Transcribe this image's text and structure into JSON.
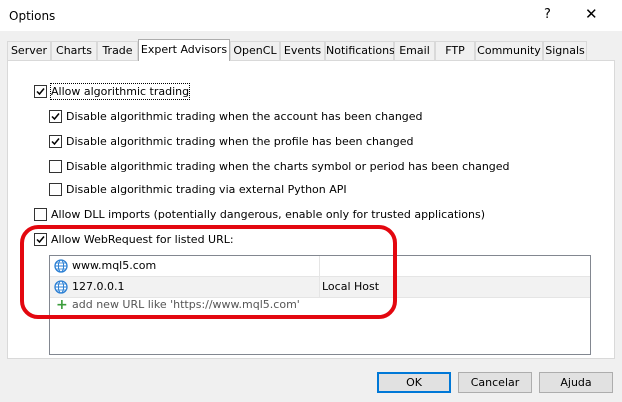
{
  "window": {
    "title": "Options",
    "help_glyph": "?",
    "close_glyph": "✕"
  },
  "tabs": [
    {
      "label": "Server"
    },
    {
      "label": "Charts"
    },
    {
      "label": "Trade"
    },
    {
      "label": "Expert Advisors",
      "active": true
    },
    {
      "label": "OpenCL"
    },
    {
      "label": "Events"
    },
    {
      "label": "Notifications"
    },
    {
      "label": "Email"
    },
    {
      "label": "FTP"
    },
    {
      "label": "Community"
    },
    {
      "label": "Signals"
    }
  ],
  "options": {
    "allow_algo": {
      "label": "Allow algorithmic trading",
      "checked": true
    },
    "disable_account": {
      "label": "Disable algorithmic trading when the account has been changed",
      "checked": true
    },
    "disable_profile": {
      "label": "Disable algorithmic trading when the profile has been changed",
      "checked": true
    },
    "disable_symbol": {
      "label": "Disable algorithmic trading when the charts symbol or period has been changed",
      "checked": false
    },
    "disable_python": {
      "label": "Disable algorithmic trading via external Python API",
      "checked": false
    },
    "allow_dll": {
      "label": "Allow DLL imports (potentially dangerous, enable only for trusted applications)",
      "checked": false
    },
    "allow_webrequest": {
      "label": "Allow WebRequest for listed URL:",
      "checked": true
    }
  },
  "url_list": {
    "rows": [
      {
        "url": "www.mql5.com",
        "description": "",
        "icon": "globe-icon"
      },
      {
        "url": "127.0.0.1",
        "description": "Local Host",
        "icon": "globe-icon"
      }
    ],
    "add_label": "add new URL like 'https://www.mql5.com'"
  },
  "buttons": {
    "ok": "OK",
    "cancel": "Cancelar",
    "help": "Ajuda"
  },
  "colors": {
    "highlight": "#e3070f",
    "accent": "#0078d7",
    "add_plus": "#3c9d3c"
  }
}
